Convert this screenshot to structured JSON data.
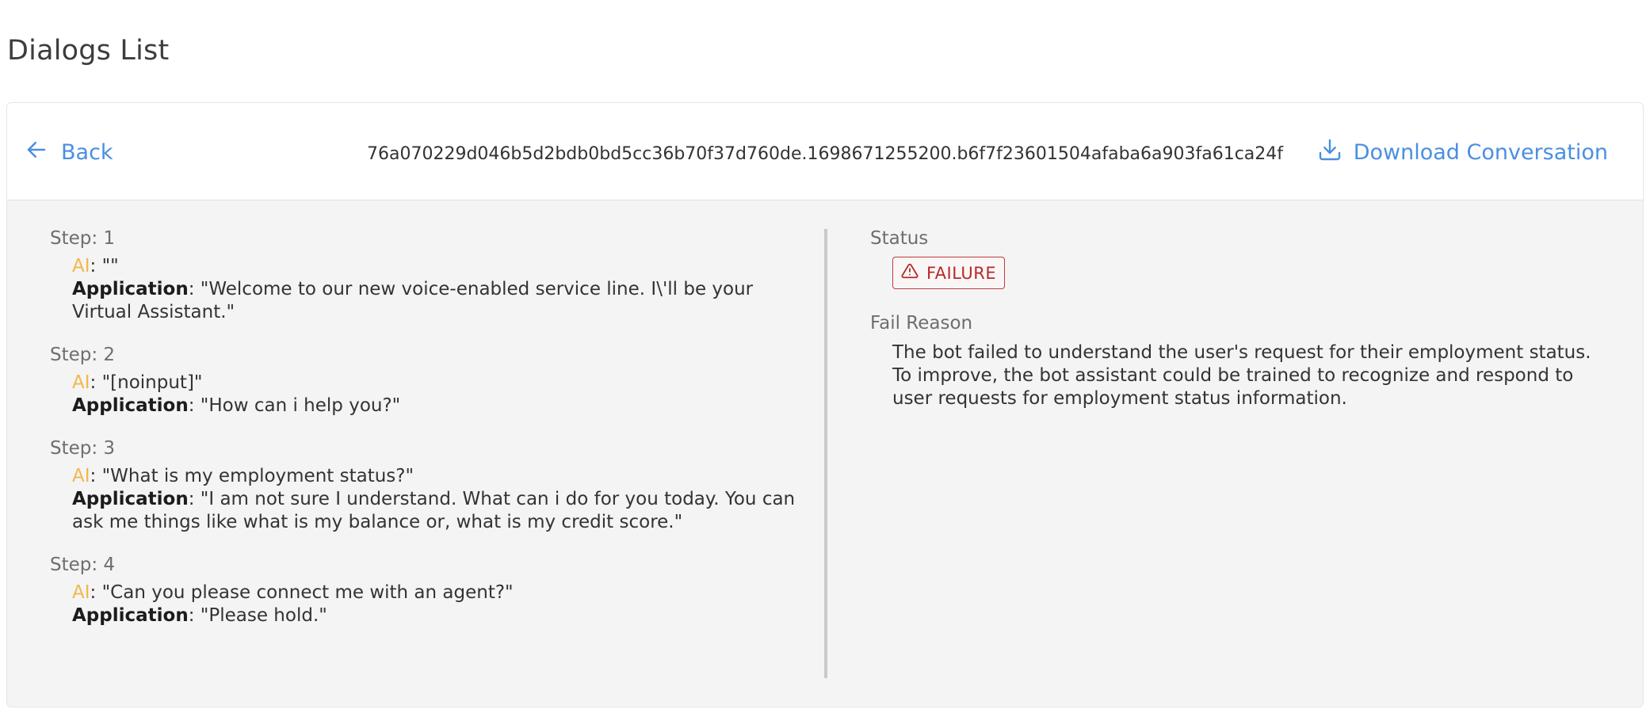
{
  "page": {
    "title": "Dialogs List"
  },
  "header": {
    "back_label": "Back",
    "conversation_id": "76a070229d046b5d2bdb0bd5cc36b70f37d760de.1698671255200.b6f7f23601504afaba6a903fa61ca24f",
    "download_label": "Download Conversation"
  },
  "steps": [
    {
      "label": "Step: 1",
      "ai_speaker": "AI",
      "ai_text": ": \"\"",
      "app_speaker": "Application",
      "app_text": ": \"Welcome to our new voice-enabled service line. I\\'ll be your Virtual Assistant.\""
    },
    {
      "label": "Step: 2",
      "ai_speaker": "AI",
      "ai_text": ": \"[noinput]\"",
      "app_speaker": "Application",
      "app_text": ": \"How can i help you?\""
    },
    {
      "label": "Step: 3",
      "ai_speaker": "AI",
      "ai_text": ": \"What is my employment status?\"",
      "app_speaker": "Application",
      "app_text": ": \"I am not sure I understand. What can i do for you today. You can ask me things like what is my balance or, what is my credit score.\""
    },
    {
      "label": "Step: 4",
      "ai_speaker": "AI",
      "ai_text": ": \"Can you please connect me with an agent?\"",
      "app_speaker": "Application",
      "app_text": ": \"Please hold.\""
    }
  ],
  "status": {
    "label": "Status",
    "value": "FAILURE",
    "color": "#b52a2a",
    "icon": "warning-triangle-icon"
  },
  "fail_reason": {
    "label": "Fail Reason",
    "text": "The bot failed to understand the user's request for their employment status. To improve, the bot assistant could be trained to recognize and respond to user requests for employment status information."
  },
  "colors": {
    "accent": "#4a8fe0",
    "ai_speaker": "#f2b84b",
    "panel_bg": "#f4f4f4"
  },
  "icons": {
    "back": "arrow-left-icon",
    "download": "download-icon"
  }
}
